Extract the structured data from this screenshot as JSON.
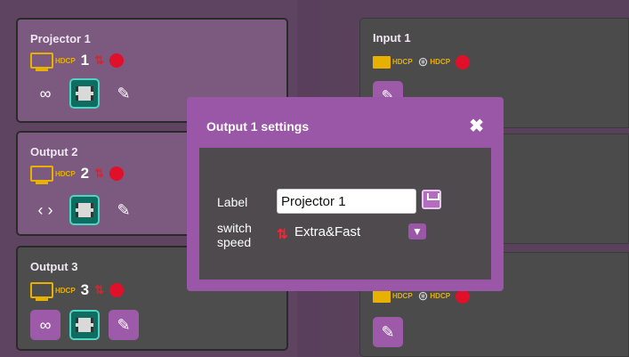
{
  "outputs": [
    {
      "title": "Projector 1",
      "number": "1"
    },
    {
      "title": "Output 2",
      "number": "2"
    },
    {
      "title": "Output 3",
      "number": "3"
    }
  ],
  "inputs": [
    {
      "title": "Input 1"
    }
  ],
  "port_badge": "HDCP",
  "dialog": {
    "title": "Output 1 settings",
    "close": "✖",
    "label_caption": "Label",
    "label_value": "Projector 1",
    "speed_caption_line1": "switch",
    "speed_caption_line2": "speed",
    "speed_value": "Extra&Fast",
    "speed_arrows": "⇅"
  },
  "icons": {
    "link": "link-icon",
    "unlink": "unlink-icon",
    "film": "film-icon",
    "edit": "pencil-icon",
    "save": "save-icon",
    "dropdown": "chevron-down-icon",
    "switch": "switch-arrows-icon",
    "status": "status-dot-icon"
  },
  "colors": {
    "purple_accent": "#9b57a7",
    "teal_accent": "#0f6c61",
    "hdcp_yellow": "#e8b100",
    "status_red": "#e0102a"
  }
}
